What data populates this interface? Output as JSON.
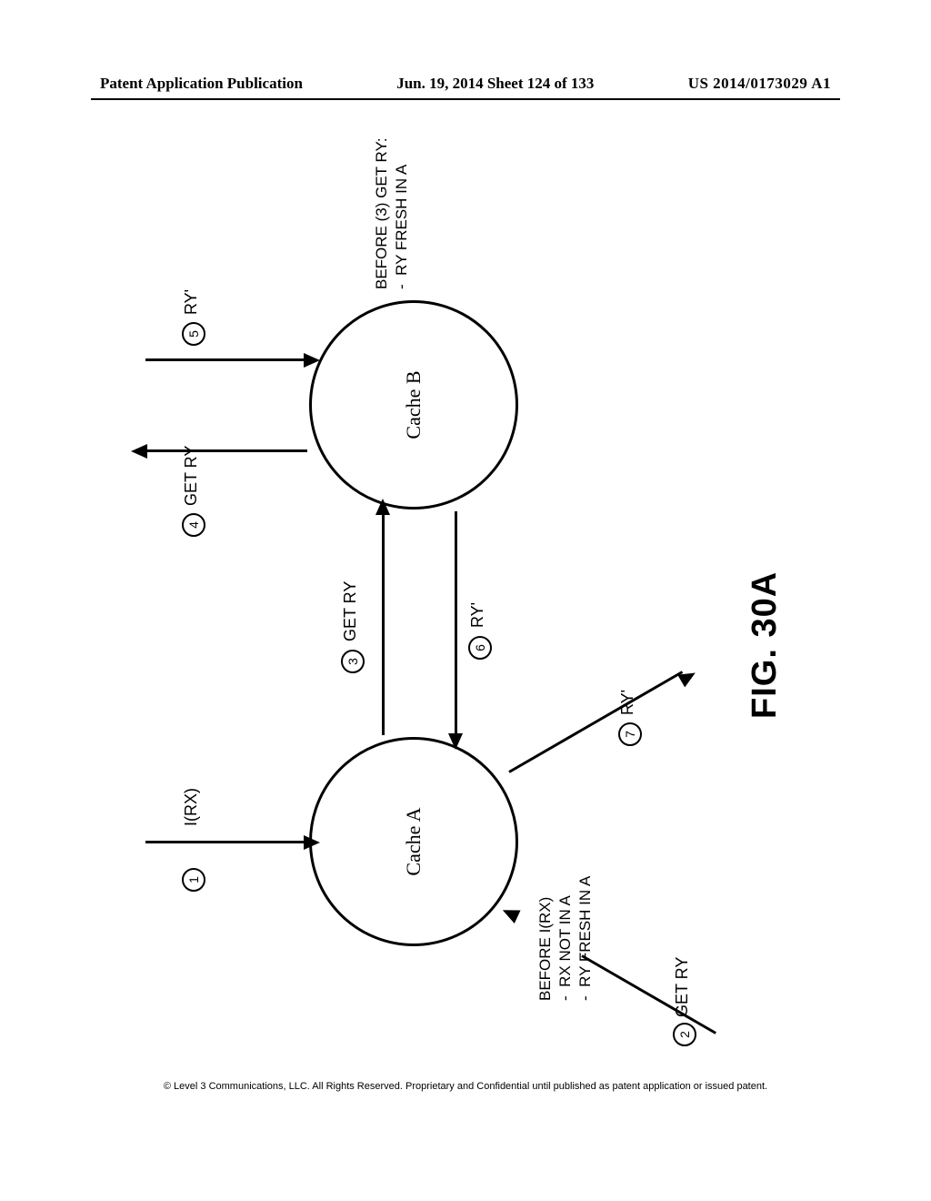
{
  "header": {
    "left": "Patent Application Publication",
    "middle": "Jun. 19, 2014  Sheet 124 of 133",
    "right": "US 2014/0173029 A1"
  },
  "diagram": {
    "cacheA": "Cache A",
    "cacheB": "Cache B",
    "annotA_title": "BEFORE I(RX)",
    "annotA_l1": "-  RX NOT IN A",
    "annotA_l2": "-  RY FRESH IN A",
    "annotB_title": "BEFORE (3) GET RY:",
    "annotB_l1": "-  RY FRESH IN A",
    "step1_label": "I(RX)",
    "step2_label": "GET RY",
    "step3_label": "GET RY",
    "step4_label": "GET RY",
    "step5_label": "RY'",
    "step6_label": "RY'",
    "step7_label": "RY'",
    "s1": "1",
    "s2": "2",
    "s3": "3",
    "s4": "4",
    "s5": "5",
    "s6": "6",
    "s7": "7",
    "figtitle": "FIG. 30A"
  },
  "footer": "© Level 3 Communications, LLC.  All Rights Reserved.  Proprietary and Confidential until published as patent application or issued patent."
}
